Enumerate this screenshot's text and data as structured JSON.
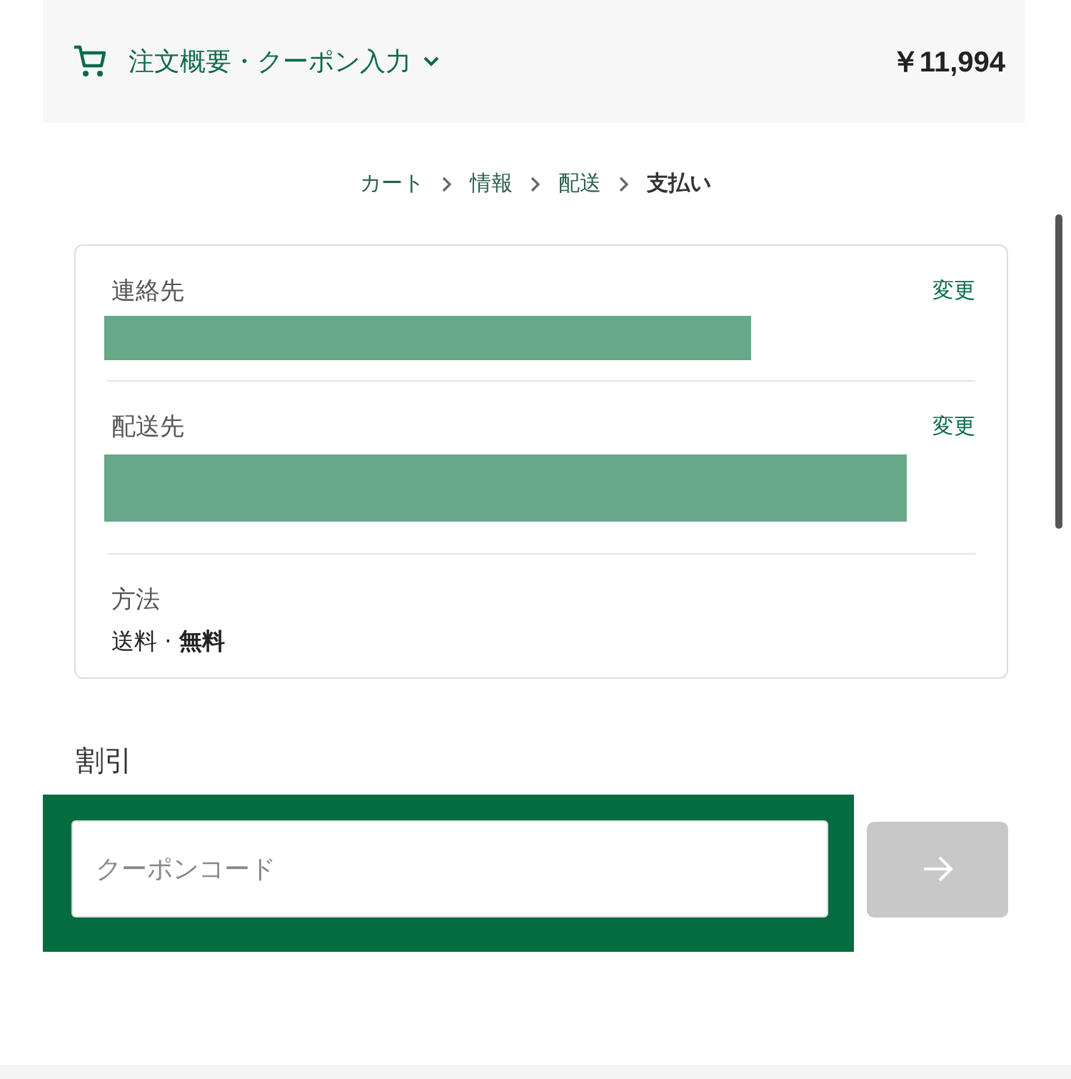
{
  "header": {
    "summary_toggle": "注文概要・クーポン入力",
    "expanded": false,
    "total": "￥11,994"
  },
  "breadcrumb": [
    {
      "label": "カート",
      "selected": false
    },
    {
      "label": "情報",
      "selected": false
    },
    {
      "label": "配送",
      "selected": false
    },
    {
      "label": "支払い",
      "selected": true
    }
  ],
  "review": [
    {
      "label": "連絡先",
      "action": "変更",
      "redacted": true,
      "kind": "short"
    },
    {
      "label": "配送先",
      "action": "変更",
      "redacted": true,
      "kind": "tall"
    },
    {
      "label": "方法",
      "value": "送料 · **無料**",
      "kind": "plain"
    }
  ],
  "discount": {
    "heading": "割引",
    "placeholder": "クーポンコード",
    "highlighted": true,
    "submit_disabled": true
  }
}
